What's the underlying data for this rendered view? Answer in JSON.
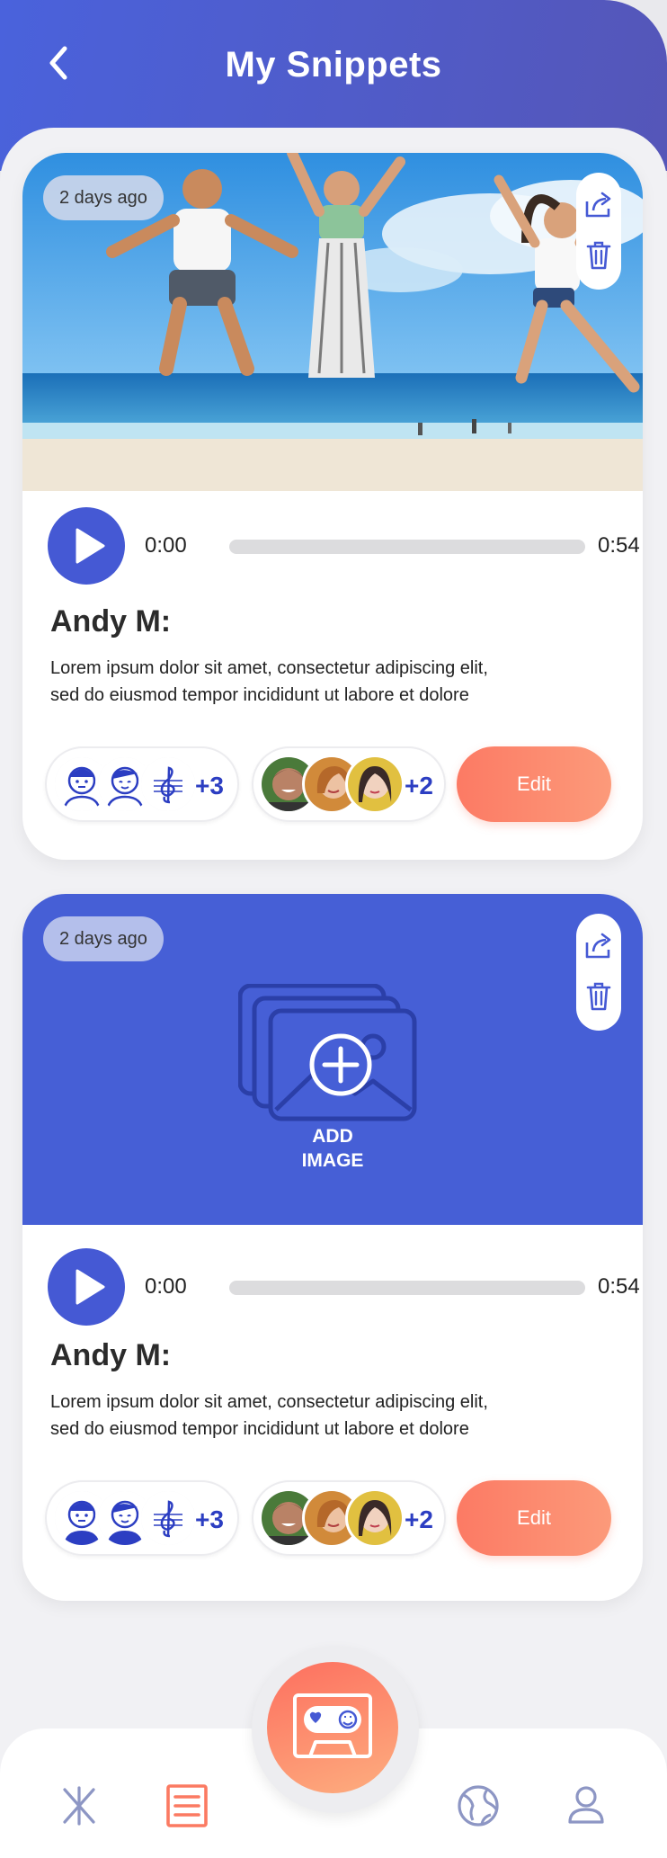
{
  "header": {
    "title": "My Snippets",
    "back_icon": "chevron-left-icon"
  },
  "snippets": [
    {
      "time_badge": "2 days ago",
      "media": "photo",
      "player": {
        "current": "0:00",
        "duration": "0:54",
        "progress": 0
      },
      "author": "Andy M:",
      "description_line1": "Lorem ipsum dolor sit amet, consectetur adipiscing elit,",
      "description_line2": "sed do eiusmod tempor incididunt ut labore et dolore",
      "group_1_count": "+3",
      "group_2_count": "+2",
      "edit_label": "Edit"
    },
    {
      "time_badge": "2 days ago",
      "media": "placeholder",
      "add_image_label": "ADD\nIMAGE",
      "player": {
        "current": "0:00",
        "duration": "0:54",
        "progress": 0
      },
      "author": "Andy M:",
      "description_line1": "Lorem ipsum dolor sit amet, consectetur adipiscing elit,",
      "description_line2": "sed do eiusmod tempor incididunt ut labore et dolore",
      "group_1_count": "+3",
      "group_2_count": "+2",
      "edit_label": "Edit"
    }
  ],
  "nav": {
    "items": [
      "sparkle-icon",
      "list-icon",
      "cassette-icon",
      "globe-icon",
      "profile-icon"
    ],
    "active": "list-icon"
  },
  "colors": {
    "primary": "#4559d4",
    "accent": "#fc7a64",
    "header_end": "#5556b8"
  }
}
